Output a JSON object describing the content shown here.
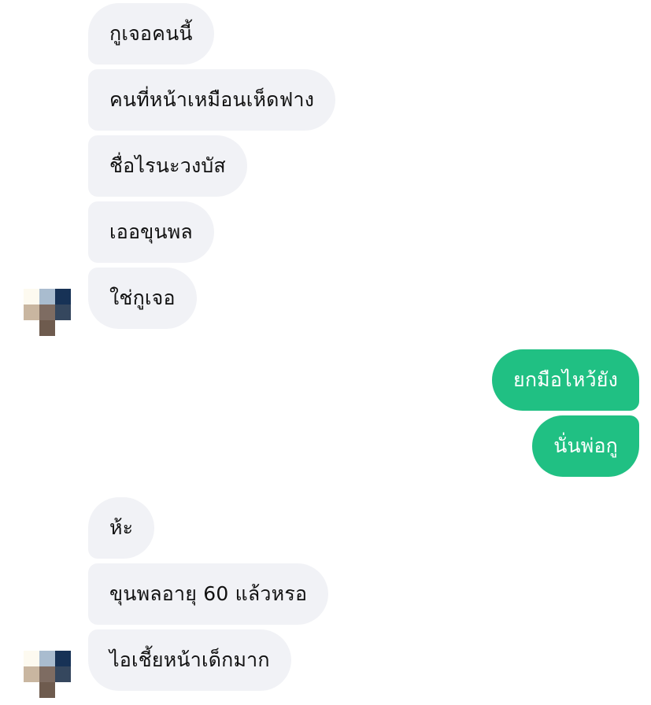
{
  "conversation": {
    "group1": [
      {
        "text": "กูเจอคนนี้"
      },
      {
        "text": "คนที่หน้าเหมือนเห็ดฟาง"
      },
      {
        "text": "ชื่อไรนะวงบัส"
      },
      {
        "text": "เออขุนพล"
      },
      {
        "text": "ใช่กูเจอ"
      }
    ],
    "group2": [
      {
        "text": "ยกมือไหว้ยัง"
      },
      {
        "text": "นั่นพ่อกู"
      }
    ],
    "group3": [
      {
        "text": "ห้ะ"
      },
      {
        "text": "ขุนพลอายุ 60 แล้วหรอ"
      },
      {
        "text": "ไอเชี้ยหน้าเด็กมาก"
      }
    ]
  },
  "colors": {
    "incoming_bubble": "#f1f2f6",
    "outgoing_bubble": "#20c083",
    "incoming_text": "#111111",
    "outgoing_text": "#ffffff"
  },
  "avatar": {
    "icon": "pixelated-profile-avatar"
  }
}
